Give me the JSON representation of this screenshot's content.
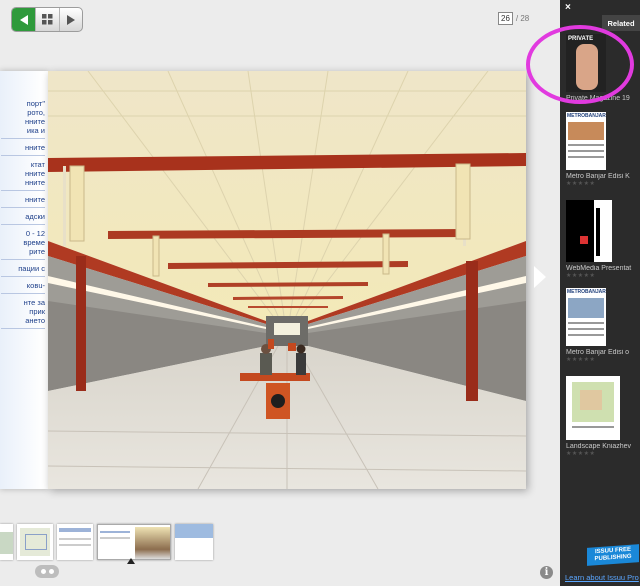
{
  "nav": {
    "back_icon": "back-arrow-icon",
    "grid_icon": "grid-icon",
    "forward_icon": "forward-arrow-icon"
  },
  "pager": {
    "current": "26",
    "total": "/ 28"
  },
  "left_page_lines": [
    "порт\"",
    "рото,",
    "нните",
    "ика и",
    "нните",
    "ктат",
    "нните",
    "нните",
    "нните",
    "адски",
    "0 - 12",
    "време",
    "рите",
    "пации с",
    "ковu-",
    "нте за",
    "прик",
    "ането"
  ],
  "sidebar": {
    "close": "×",
    "tab": "Related",
    "items": [
      {
        "title": "Private Magazine 19",
        "stars": "★★★★★"
      },
      {
        "title": "Metro Banjar Edisi K",
        "stars": "★★★★★"
      },
      {
        "title": "WebMedia Presentat",
        "stars": "★★★★★"
      },
      {
        "title": "Metro Banjar Edisi o",
        "stars": "★★★★★"
      },
      {
        "title": "Landscape Kniazhev",
        "stars": "★★★★★"
      }
    ],
    "cover_texts": {
      "private": "PRIVATE",
      "metro1": "METROBANJAR",
      "metro2": "METROBANJAR"
    },
    "badge": "ISSUU FREE PUBLISHING",
    "learn_more": "Learn about Issuu Pro"
  },
  "info_label": "i",
  "colors": {
    "accent_green": "#2f9a3c",
    "highlight_circle": "#e13adf",
    "sidebar_bg": "#2b2b2b",
    "link_blue": "#5aa6ff"
  }
}
